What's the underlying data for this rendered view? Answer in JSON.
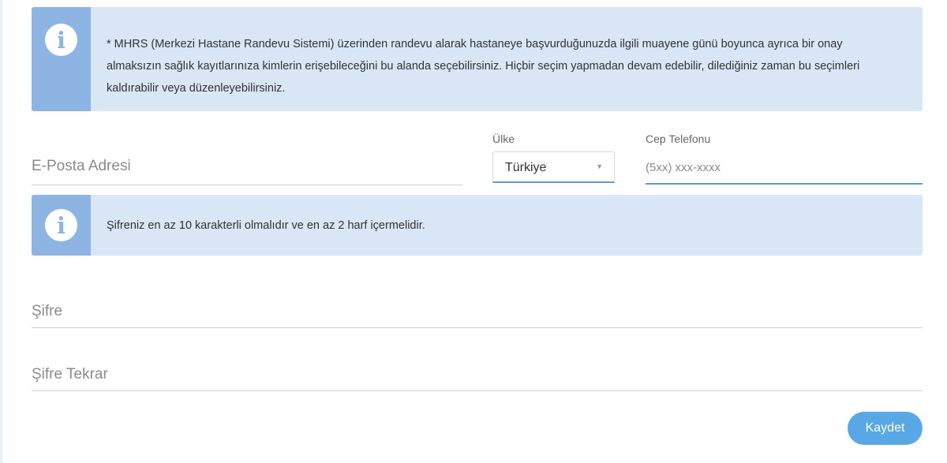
{
  "notices": {
    "sharing_info": "* MHRS (Merkezi Hastane Randevu Sistemi) üzerinden randevu alarak hastaneye başvurduğunuzda ilgili muayene günü boyunca ayrıca bir onay almaksızın sağlık kayıtlarınıza kimlerin erişebileceğini bu alanda seçebilirsiniz. Hiçbir seçim yapmadan devam edebilir, dilediğiniz zaman bu seçimleri kaldırabilir veya düzenleyebilirsiniz.",
    "password_rule": "Şifreniz en az 10 karakterli olmalıdır ve en az 2 harf içermelidir.",
    "icon": "info-icon",
    "icon_glyph": "i"
  },
  "form": {
    "email_placeholder": "E-Posta Adresi",
    "country_label": "Ülke",
    "country_value": "Türkiye",
    "caret_glyph": "▼",
    "phone_label": "Cep Telefonu",
    "phone_placeholder": "(5xx) xxx-xxxx",
    "password_placeholder": "Şifre",
    "password_repeat_placeholder": "Şifre Tekrar",
    "save_label": "Kaydet"
  },
  "colors": {
    "accent": "#5b9bd5",
    "button": "#5aa7e6",
    "info_bg": "#d9e6f6",
    "info_icon_bg": "#8db4e3"
  }
}
